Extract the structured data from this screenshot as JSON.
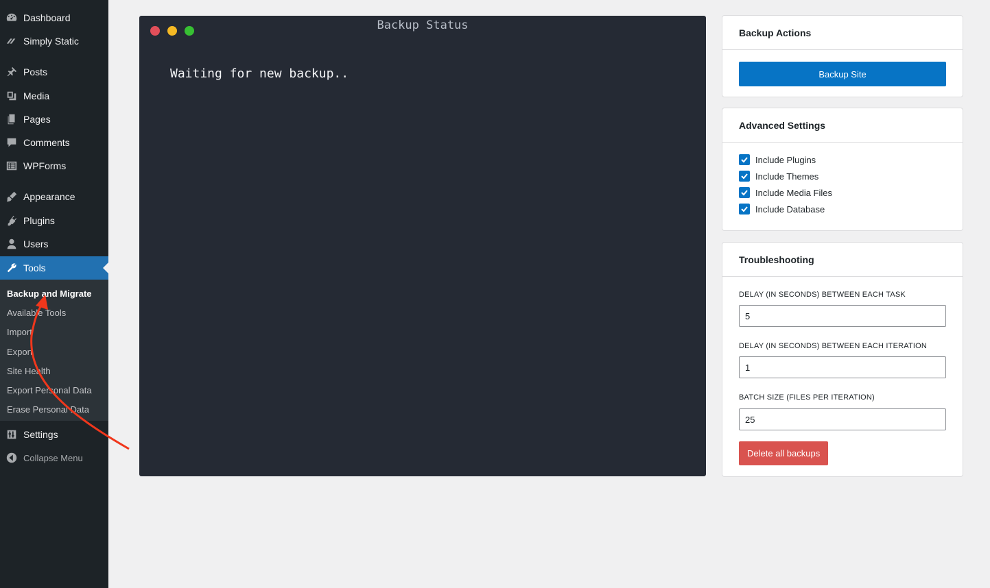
{
  "sidebar": {
    "items": [
      {
        "label": "Dashboard",
        "icon": "dashboard-icon"
      },
      {
        "label": "Simply Static",
        "icon": "simply-static-icon"
      },
      {
        "label": "Posts",
        "icon": "pin-icon"
      },
      {
        "label": "Media",
        "icon": "media-icon"
      },
      {
        "label": "Pages",
        "icon": "pages-icon"
      },
      {
        "label": "Comments",
        "icon": "comment-icon"
      },
      {
        "label": "WPForms",
        "icon": "forms-icon"
      },
      {
        "label": "Appearance",
        "icon": "brush-icon"
      },
      {
        "label": "Plugins",
        "icon": "plug-icon"
      },
      {
        "label": "Users",
        "icon": "user-icon"
      },
      {
        "label": "Tools",
        "icon": "wrench-icon"
      },
      {
        "label": "Settings",
        "icon": "sliders-icon"
      },
      {
        "label": "Collapse Menu",
        "icon": "collapse-icon"
      }
    ],
    "submenu": [
      "Backup and Migrate",
      "Available Tools",
      "Import",
      "Export",
      "Site Health",
      "Export Personal Data",
      "Erase Personal Data"
    ]
  },
  "terminal": {
    "title": "Backup Status",
    "message": "Waiting for new backup.."
  },
  "backup_actions": {
    "title": "Backup Actions",
    "button": "Backup Site"
  },
  "advanced": {
    "title": "Advanced Settings",
    "options": [
      {
        "label": "Include Plugins",
        "checked": true
      },
      {
        "label": "Include Themes",
        "checked": true
      },
      {
        "label": "Include Media Files",
        "checked": true
      },
      {
        "label": "Include Database",
        "checked": true
      }
    ]
  },
  "troubleshooting": {
    "title": "Troubleshooting",
    "fields": [
      {
        "label": "DELAY (IN SECONDS) BETWEEN EACH TASK",
        "value": "5"
      },
      {
        "label": "DELAY (IN SECONDS) BETWEEN EACH ITERATION",
        "value": "1"
      },
      {
        "label": "BATCH SIZE (FILES PER ITERATION)",
        "value": "25"
      }
    ],
    "delete_button": "Delete all backups"
  },
  "colors": {
    "accent": "#2271b1",
    "button_primary": "#0774c5",
    "danger": "#d9534f",
    "annotation_arrow": "#f0371c"
  }
}
